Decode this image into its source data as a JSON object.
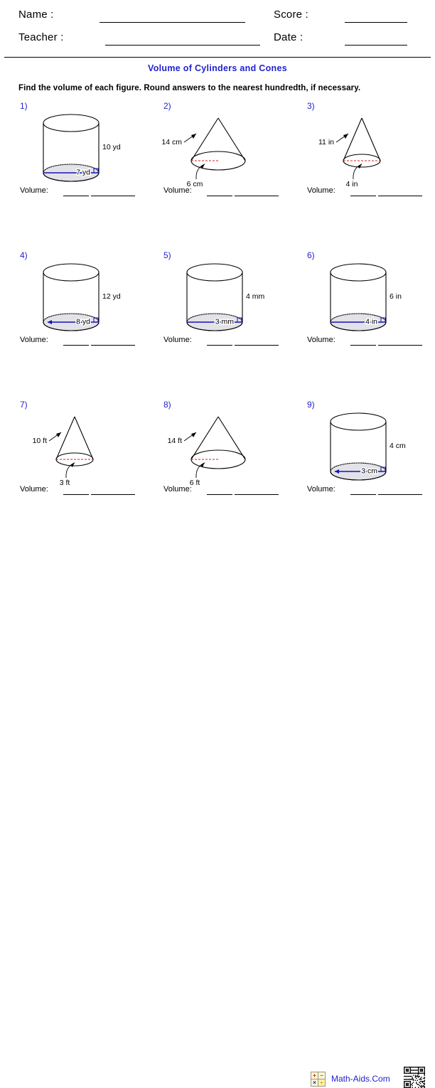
{
  "header": {
    "name_label": "Name :",
    "score_label": "Score :",
    "teacher_label": "Teacher :",
    "date_label": "Date :",
    "name_value": "",
    "score_value": "",
    "teacher_value": "",
    "date_value": ""
  },
  "title": "Volume of Cylinders and Cones",
  "title_color": "#2222cc",
  "instructions": "Find the volume of each figure. Round answers to the nearest hundredth, if necessary.",
  "volume_label": "Volume:",
  "problems": [
    {
      "number": "1)",
      "shape": "cylinder",
      "height_label": "10 yd",
      "base_label": "7 yd",
      "base_type": "diameter",
      "units": "yd",
      "height_value": 10,
      "base_value": 7
    },
    {
      "number": "2)",
      "shape": "cone",
      "height_label": "14 cm",
      "base_label": "6 cm",
      "base_type": "radius",
      "units": "cm",
      "height_value": 14,
      "base_value": 6
    },
    {
      "number": "3)",
      "shape": "cone",
      "height_label": "11 in",
      "base_label": "4 in",
      "base_type": "diameter",
      "units": "in",
      "height_value": 11,
      "base_value": 4
    },
    {
      "number": "4)",
      "shape": "cylinder",
      "height_label": "12 yd",
      "base_label": "8 yd",
      "base_type": "radius",
      "units": "yd",
      "height_value": 12,
      "base_value": 8
    },
    {
      "number": "5)",
      "shape": "cylinder",
      "height_label": "4 mm",
      "base_label": "3 mm",
      "base_type": "diameter",
      "units": "mm",
      "height_value": 4,
      "base_value": 3
    },
    {
      "number": "6)",
      "shape": "cylinder",
      "height_label": "6 in",
      "base_label": "4 in",
      "base_type": "diameter",
      "units": "in",
      "height_value": 6,
      "base_value": 4
    },
    {
      "number": "7)",
      "shape": "cone",
      "height_label": "10 ft",
      "base_label": "3 ft",
      "base_type": "diameter",
      "units": "ft",
      "height_value": 10,
      "base_value": 3
    },
    {
      "number": "8)",
      "shape": "cone",
      "height_label": "14 ft",
      "base_label": "6 ft",
      "base_type": "radius",
      "units": "ft",
      "height_value": 14,
      "base_value": 6
    },
    {
      "number": "9)",
      "shape": "cylinder",
      "height_label": "4 cm",
      "base_label": "3 cm",
      "base_type": "radius",
      "units": "cm",
      "height_value": 4,
      "base_value": 3
    }
  ],
  "footer": {
    "brand_text": "Math-Aids.Com",
    "brand_color": "#2222cc",
    "icon_name": "math-operators-icon",
    "operators": [
      "+",
      "−",
      "×",
      "÷"
    ],
    "qr_name": "qr-code"
  }
}
